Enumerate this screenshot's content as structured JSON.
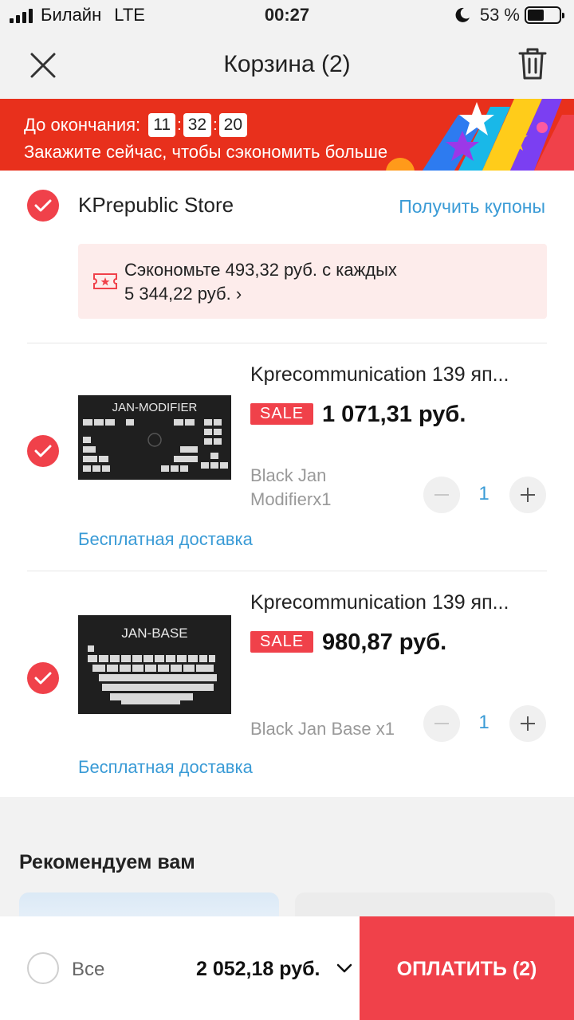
{
  "status_bar": {
    "carrier": "Билайн",
    "network": "LTE",
    "time": "00:27",
    "battery": "53 %",
    "battery_level": 0.53
  },
  "header": {
    "title": "Корзина (2)",
    "close_icon": "close-icon",
    "trash_icon": "trash-icon"
  },
  "banner": {
    "ends_label": "До окончания:",
    "timer": [
      "11",
      "32",
      "20"
    ],
    "sep": ":",
    "subtitle": "Закажите сейчас, чтобы сэкономить больше"
  },
  "store": {
    "name": "KPrepublic Store",
    "coupons_link": "Получить купоны",
    "savings_line1": "Сэкономьте 493,32 руб. с каждых",
    "savings_line2": "5 344,22 руб.",
    "savings_chevron": "›"
  },
  "items": [
    {
      "name": "Kprecommunication 139 яп...",
      "thumb_label": "JAN-MODIFIER",
      "sale": "SALE",
      "price": "1 071,31 руб.",
      "variant_line1": "Black Jan",
      "variant_line2": "Modifierx1",
      "qty": "1",
      "shipping": "Бесплатная доставка"
    },
    {
      "name": "Kprecommunication 139 яп...",
      "thumb_label": "JAN-BASE",
      "sale": "SALE",
      "price": "980,87 руб.",
      "variant_line1": "Black Jan Base x1",
      "qty": "1",
      "shipping": "Бесплатная доставка"
    }
  ],
  "recommend": {
    "title": "Рекомендуем вам"
  },
  "bottom_bar": {
    "all_label": "Все",
    "total": "2 052,18 руб.",
    "pay_button": "ОПЛАТИТЬ (2)"
  },
  "colors": {
    "accent": "#f0414a",
    "banner": "#e8301c",
    "link": "#3a9bd6"
  }
}
